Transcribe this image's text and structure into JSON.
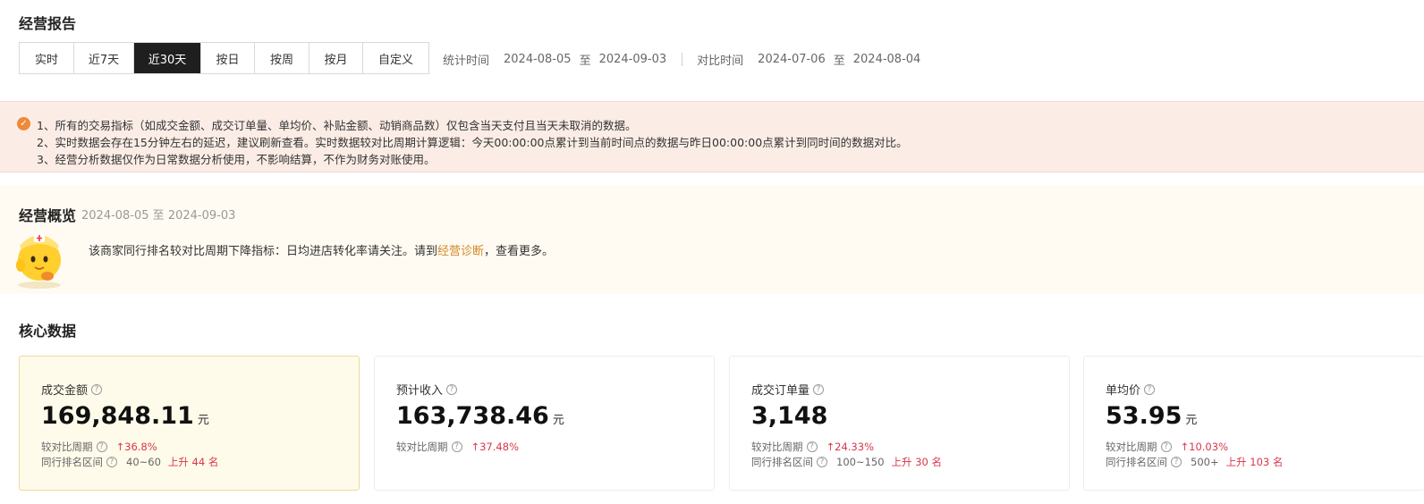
{
  "report": {
    "title": "经营报告",
    "range_tabs": [
      {
        "label": "实时"
      },
      {
        "label": "近7天"
      },
      {
        "label": "近30天"
      },
      {
        "label": "按日"
      },
      {
        "label": "按周"
      },
      {
        "label": "按月"
      },
      {
        "label": "自定义"
      }
    ],
    "active_tab": "近30天",
    "stat_label": "统计时间",
    "stat_start": "2024-08-05",
    "to_word": "至",
    "stat_end": "2024-09-03",
    "compare_label": "对比时间",
    "compare_start": "2024-07-06",
    "compare_end": "2024-08-04"
  },
  "notice": {
    "icon": "check-circle-icon",
    "lines": [
      "1、所有的交易指标（如成交金额、成交订单量、单均价、补贴金额、动销商品数）仅包含当天支付且当天未取消的数据。",
      "2、实时数据会存在15分钟左右的延迟，建议刷新查看。实时数据较对比周期计算逻辑：今天00:00:00点累计到当前时间点的数据与昨日00:00:00点累计到同时间的数据对比。",
      "3、经营分析数据仅作为日常数据分析使用，不影响结算，不作为财务对账使用。"
    ]
  },
  "overview": {
    "title": "经营概览",
    "date_range": "2024-08-05 至 2024-09-03",
    "msg_before": "该商家同行排名较对比周期下降指标：日均进店转化率请关注。请到",
    "msg_link": "经营诊断",
    "msg_after": "，查看更多。"
  },
  "core": {
    "title": "核心数据",
    "cards": [
      {
        "label": "成交金额",
        "value": "169,848.11",
        "unit": "元",
        "compare_label": "较对比周期",
        "change": "36.8%",
        "rank_label": "同行排名区间",
        "rank_range": "40~60",
        "rank_change": "上升 44 名"
      },
      {
        "label": "预计收入",
        "value": "163,738.46",
        "unit": "元",
        "compare_label": "较对比周期",
        "change": "37.48%"
      },
      {
        "label": "成交订单量",
        "value": "3,148",
        "unit": "",
        "compare_label": "较对比周期",
        "change": "24.33%",
        "rank_label": "同行排名区间",
        "rank_range": "100~150",
        "rank_change": "上升 30 名"
      },
      {
        "label": "单均价",
        "value": "53.95",
        "unit": "元",
        "compare_label": "较对比周期",
        "change": "10.03%",
        "rank_label": "同行排名区间",
        "rank_range": "500+",
        "rank_change": "上升 103 名"
      }
    ]
  },
  "colors": {
    "accent_dark": "#1f1f1f",
    "notice_bg": "#fbede6",
    "overview_bg": "#fffbf2",
    "up_red": "#d9364a",
    "link_orange": "#d48a2a"
  }
}
